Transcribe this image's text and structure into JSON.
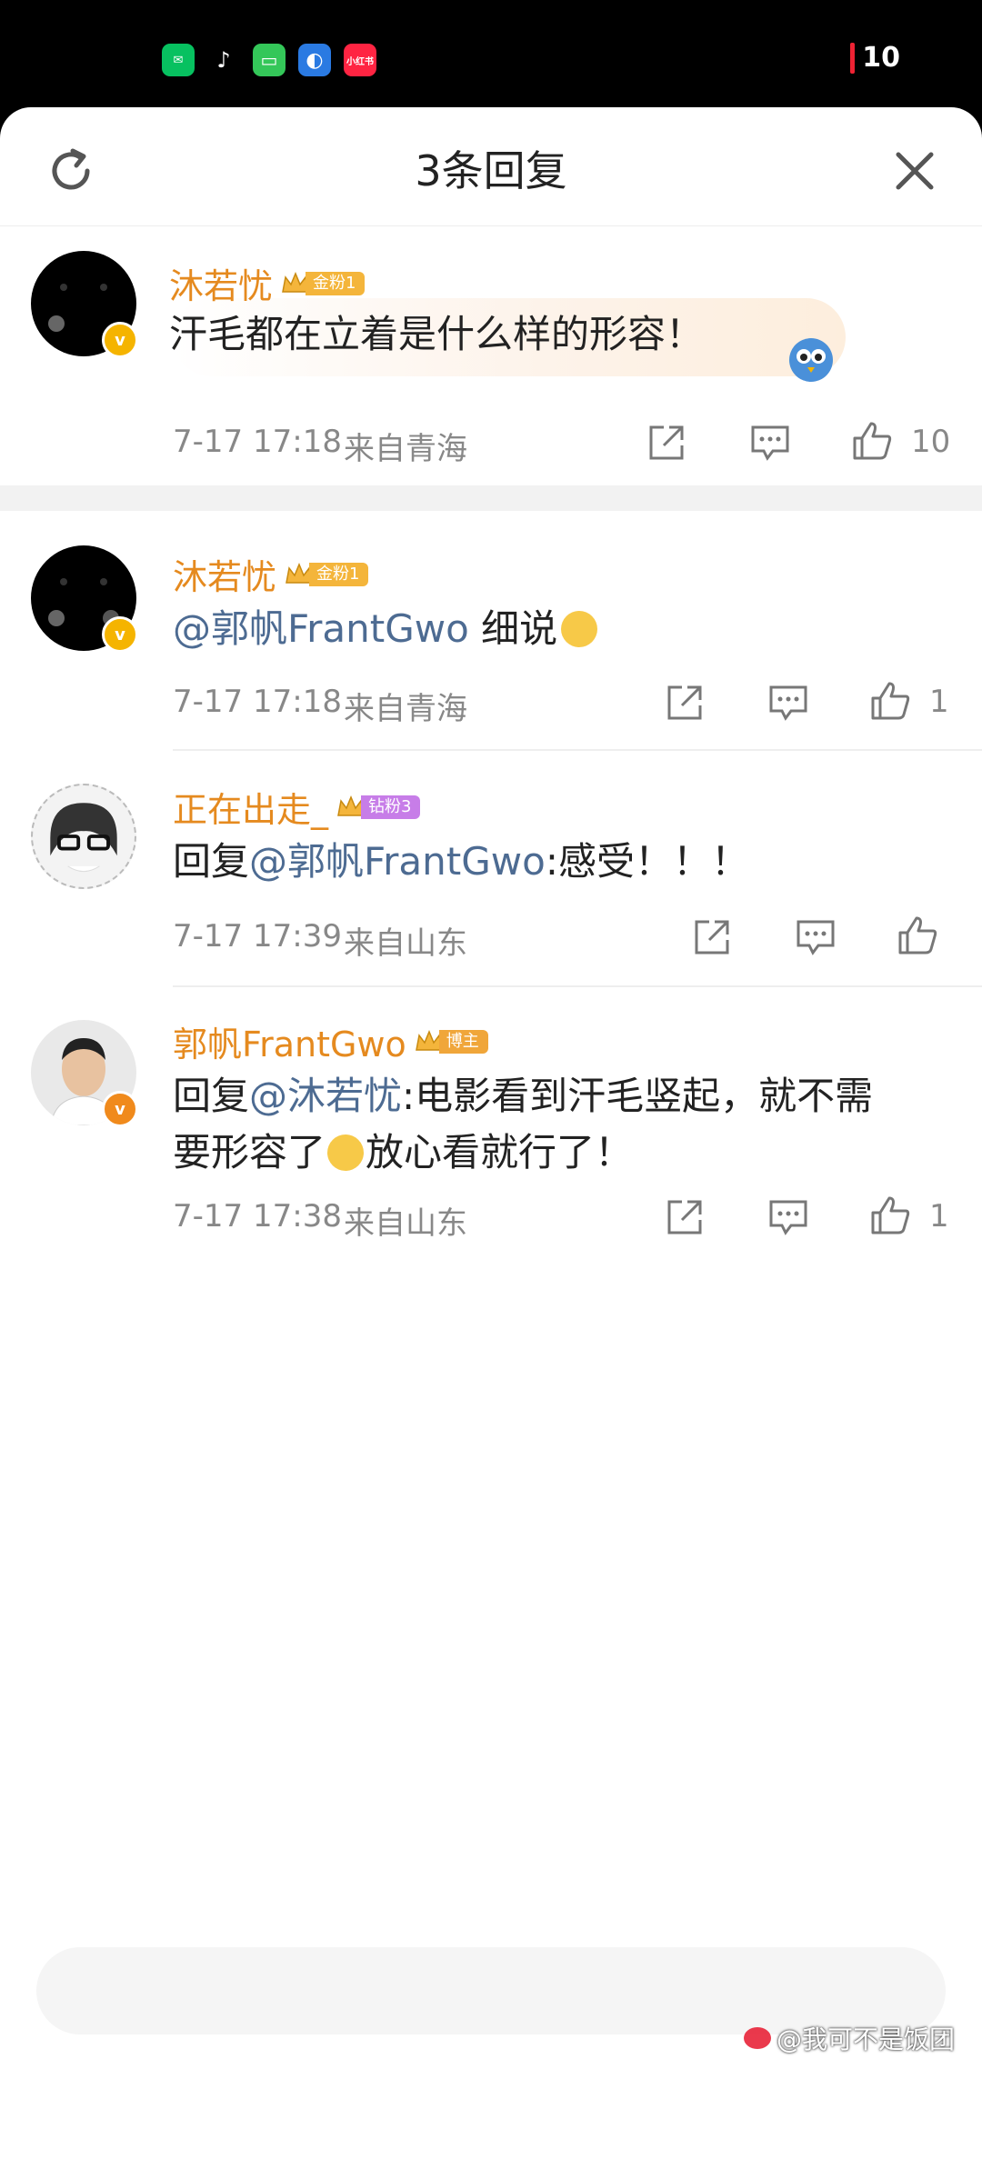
{
  "status_bar": {
    "apps": [
      {
        "name": "wechat-icon",
        "color": "#07c160",
        "glyph": "✉"
      },
      {
        "name": "tiktok-icon",
        "color": "#000000",
        "glyph": "♪"
      },
      {
        "name": "messages-icon",
        "color": "#34c759",
        "glyph": "▭"
      },
      {
        "name": "browser-icon",
        "color": "#2a7ae2",
        "glyph": "◐"
      },
      {
        "name": "xiaohongshu-icon",
        "color": "#ff2442",
        "glyph": "小红书"
      }
    ],
    "battery": "10"
  },
  "sheet": {
    "title": "3条回复"
  },
  "comments": [
    {
      "name": "沐若忧",
      "fan_badge": "金粉1",
      "text": "汗毛都在立着是什么样的形容！",
      "time": "7-17 17:18",
      "location": "来自青海",
      "likes": "10"
    },
    {
      "name": "沐若忧",
      "fan_badge": "金粉1",
      "mention": "@郭帆FrantGwo",
      "text": " 细说",
      "time": "7-17 17:18",
      "location": "来自青海",
      "likes": "1"
    },
    {
      "name": "正在出走_",
      "fan_badge": "钻粉3",
      "prefix": "回复",
      "mention": "@郭帆FrantGwo",
      "text": ":感受！！！",
      "time": "7-17 17:39",
      "location": "来自山东",
      "likes": ""
    },
    {
      "name": "郭帆FrantGwo",
      "fan_badge": "博主",
      "prefix": "回复",
      "mention": "@沐若忧",
      "text": ":电影看到汗毛竖起，就不需",
      "text_line2": "要形容了",
      "text_line2_after": "放心看就行了！",
      "time": "7-17 17:38",
      "location": "来自山东",
      "likes": "1"
    }
  ],
  "watermark": "@我可不是饭团",
  "colors": {
    "name": "#e58a1f",
    "mention": "#4d6b92",
    "gold_badge": "#f4b53b",
    "diamond_badge": "#c77de8",
    "blogger_badge": "#f0a63a"
  }
}
